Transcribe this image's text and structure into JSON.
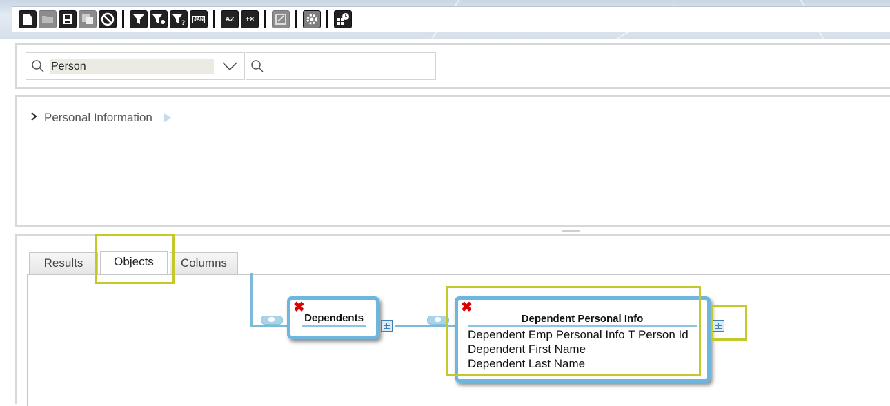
{
  "toolbar": {
    "buttons": [
      {
        "name": "new-document-icon",
        "disabled": false
      },
      {
        "name": "open-folder-icon",
        "disabled": true
      },
      {
        "name": "save-icon",
        "disabled": false
      },
      {
        "name": "save-as-icon",
        "disabled": true
      },
      {
        "name": "cancel-icon",
        "disabled": false
      },
      {
        "name": "filter-icon",
        "disabled": false
      },
      {
        "name": "filter-settings-icon",
        "disabled": false
      },
      {
        "name": "filter-help-icon",
        "disabled": false
      },
      {
        "name": "date-filter-icon",
        "disabled": false
      },
      {
        "name": "sort-az-icon",
        "disabled": false
      },
      {
        "name": "calculator-icon",
        "disabled": false
      },
      {
        "name": "transform-icon",
        "disabled": true
      },
      {
        "name": "gear-icon",
        "disabled": false
      },
      {
        "name": "schedule-grid-icon",
        "disabled": false
      }
    ],
    "date_icon_text": "JAN",
    "sort_icon_text": "AZ",
    "calc_icon_text": "+×"
  },
  "search": {
    "combo_value": "Person",
    "query_value": "",
    "query_placeholder": ""
  },
  "tree": {
    "node_label": "Personal Information"
  },
  "tabs": [
    {
      "label": "Results",
      "active": false
    },
    {
      "label": "Objects",
      "active": true
    },
    {
      "label": "Columns",
      "active": false
    }
  ],
  "diagram": {
    "entities": [
      {
        "title": "Dependents",
        "fields": []
      },
      {
        "title": "Dependent Personal Info",
        "fields": [
          "Dependent Emp Personal Info T Person Id",
          "Dependent First Name",
          "Dependent Last Name"
        ]
      }
    ],
    "remove_symbol": "✖"
  },
  "colors": {
    "highlight": "#c3c82b",
    "entity_border": "#6eb6de",
    "connector": "#7cbad9",
    "remove": "#e00000"
  }
}
